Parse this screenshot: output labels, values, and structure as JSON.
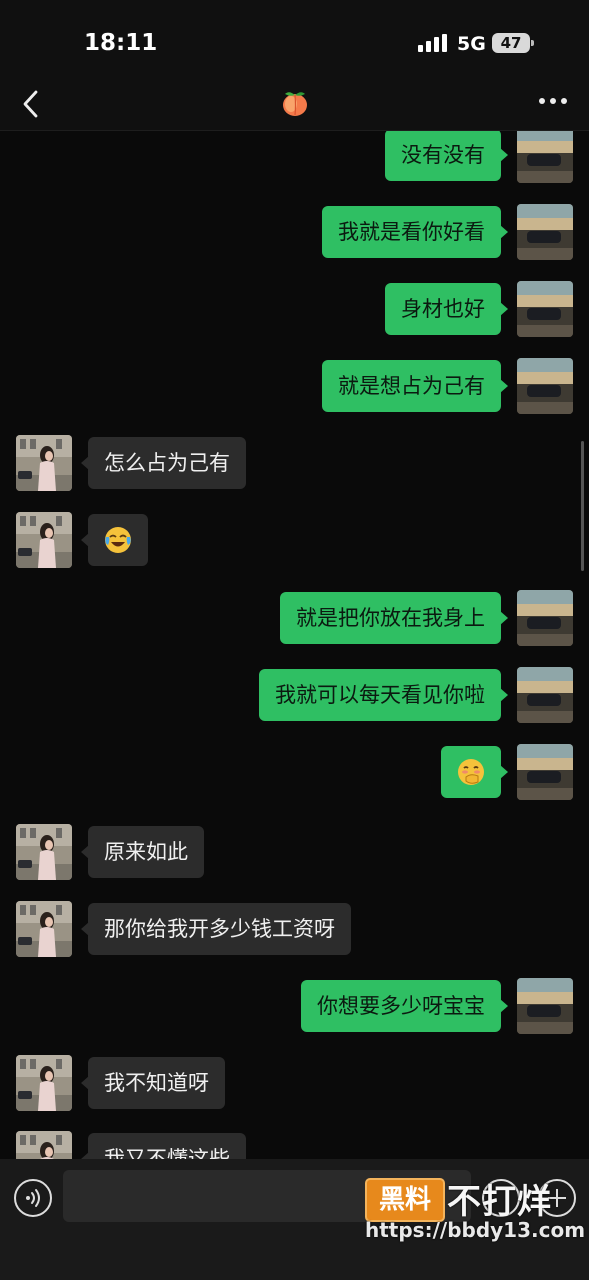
{
  "status_bar": {
    "time": "18:11",
    "network": "5G",
    "battery": "47"
  },
  "header": {
    "title_icon": "peach-emoji",
    "back_icon": "chevron-left-icon",
    "more_icon": "more-dots-icon"
  },
  "messages": [
    {
      "side": "me",
      "text": "没有没有"
    },
    {
      "side": "me",
      "text": "我就是看你好看"
    },
    {
      "side": "me",
      "text": "身材也好"
    },
    {
      "side": "me",
      "text": "就是想占为己有"
    },
    {
      "side": "them",
      "text": "怎么占为己有"
    },
    {
      "side": "them",
      "emoji": "laughing-crying-emoji"
    },
    {
      "side": "me",
      "text": "就是把你放在我身上"
    },
    {
      "side": "me",
      "text": "我就可以每天看见你啦"
    },
    {
      "side": "me",
      "emoji": "shy-hand-over-mouth-emoji"
    },
    {
      "side": "them",
      "text": "原来如此"
    },
    {
      "side": "them",
      "text": "那你给我开多少钱工资呀"
    },
    {
      "side": "me",
      "text": "你想要多少呀宝宝"
    },
    {
      "side": "them",
      "text": "我不知道呀"
    },
    {
      "side": "them",
      "text": "我又不懂这些"
    }
  ],
  "input_bar": {
    "voice_icon": "voice-icon",
    "emoji_icon": "emoji-icon",
    "add_icon": "plus-icon"
  },
  "watermark": {
    "badge": "黑料",
    "text": "不打烊",
    "url": "https://bbdy13.com"
  },
  "colors": {
    "sent_bubble": "#2fbf63",
    "received_bubble": "#2c2c2c",
    "background": "#0a0a0a",
    "watermark_orange": "#e7891c"
  }
}
